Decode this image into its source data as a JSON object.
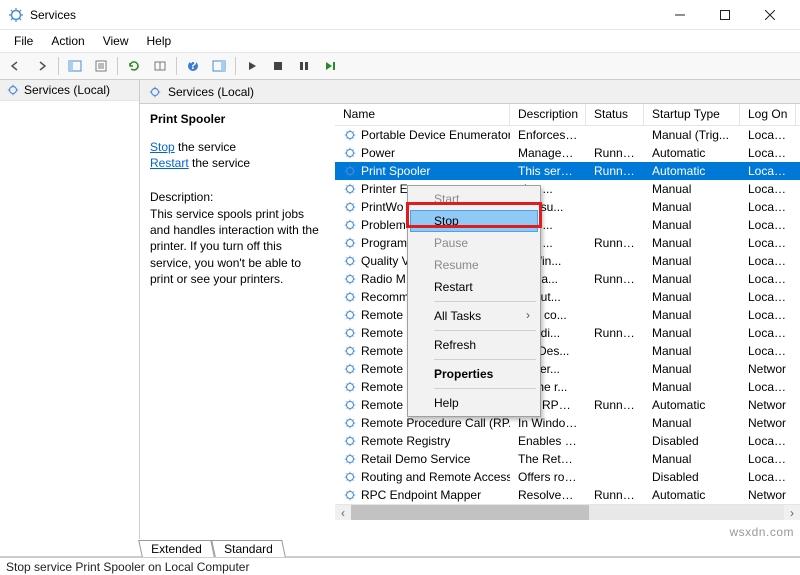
{
  "window": {
    "title": "Services"
  },
  "menus": [
    "File",
    "Action",
    "View",
    "Help"
  ],
  "left": {
    "node": "Services (Local)"
  },
  "header": {
    "title": "Services (Local)"
  },
  "detail": {
    "title": "Print Spooler",
    "action_stop_link": "Stop",
    "action_stop_rest": " the service",
    "action_restart_link": "Restart",
    "action_restart_rest": " the service",
    "desc_heading": "Description:",
    "desc_text": "This service spools print jobs and handles interaction with the printer. If you turn off this service, you won't be able to print or see your printers."
  },
  "columns": [
    "Name",
    "Description",
    "Status",
    "Startup Type",
    "Log On"
  ],
  "rows": [
    {
      "name": "Portable Device Enumerator...",
      "desc": "Enforces gr...",
      "status": "",
      "startup": "Manual (Trig...",
      "logon": "Local Sy"
    },
    {
      "name": "Power",
      "desc": "Manages p...",
      "status": "Running",
      "startup": "Automatic",
      "logon": "Local Sy"
    },
    {
      "name": "Print Spooler",
      "desc": "This service ...",
      "status": "Running",
      "startup": "Automatic",
      "logon": "Local Sy",
      "selected": true
    },
    {
      "name": "Printer E",
      "desc": "vice ...",
      "status": "",
      "startup": "Manual",
      "logon": "Local Sy"
    },
    {
      "name": "PrintWo",
      "desc": "des su...",
      "status": "",
      "startup": "Manual",
      "logon": "Local Sy"
    },
    {
      "name": "Problem",
      "desc": "vice ...",
      "status": "",
      "startup": "Manual",
      "logon": "Local Sy"
    },
    {
      "name": "Program",
      "desc": "vice ...",
      "status": "Running",
      "startup": "Manual",
      "logon": "Local Sy"
    },
    {
      "name": "Quality V",
      "desc": "ty Win...",
      "status": "",
      "startup": "Manual",
      "logon": "Local Sy"
    },
    {
      "name": "Radio M",
      "desc": "Mana...",
      "status": "Running",
      "startup": "Manual",
      "logon": "Local Sy"
    },
    {
      "name": "Recomm",
      "desc": "es aut...",
      "status": "",
      "startup": "Manual",
      "logon": "Local Sy"
    },
    {
      "name": "Remote",
      "desc": "es a co...",
      "status": "",
      "startup": "Manual",
      "logon": "Local Sy"
    },
    {
      "name": "Remote",
      "desc": "ges di...",
      "status": "Running",
      "startup": "Manual",
      "logon": "Local Sy"
    },
    {
      "name": "Remote",
      "desc": "ote Des...",
      "status": "",
      "startup": "Manual",
      "logon": "Local Sy"
    },
    {
      "name": "Remote",
      "desc": "s user...",
      "status": "",
      "startup": "Manual",
      "logon": "Networ"
    },
    {
      "name": "Remote",
      "desc": "es the r...",
      "status": "",
      "startup": "Manual",
      "logon": "Local Sy"
    },
    {
      "name": "Remote Procedure Call (RPC)",
      "desc": "The RPCSS s...",
      "status": "Running",
      "startup": "Automatic",
      "logon": "Networ"
    },
    {
      "name": "Remote Procedure Call (RP...",
      "desc": "In Windows...",
      "status": "",
      "startup": "Manual",
      "logon": "Networ"
    },
    {
      "name": "Remote Registry",
      "desc": "Enables rem...",
      "status": "",
      "startup": "Disabled",
      "logon": "Local Sy"
    },
    {
      "name": "Retail Demo Service",
      "desc": "The Retail D...",
      "status": "",
      "startup": "Manual",
      "logon": "Local Sy"
    },
    {
      "name": "Routing and Remote Access",
      "desc": "Offers routi...",
      "status": "",
      "startup": "Disabled",
      "logon": "Local Sy"
    },
    {
      "name": "RPC Endpoint Mapper",
      "desc": "Resolves RP...",
      "status": "Running",
      "startup": "Automatic",
      "logon": "Networ"
    }
  ],
  "context_menu": {
    "items": [
      {
        "label": "Start",
        "disabled": true
      },
      {
        "label": "Stop",
        "hot": true
      },
      {
        "label": "Pause",
        "disabled": true
      },
      {
        "label": "Resume",
        "disabled": true
      },
      {
        "label": "Restart"
      },
      {
        "sep": true
      },
      {
        "label": "All Tasks",
        "sub": true
      },
      {
        "sep": true
      },
      {
        "label": "Refresh"
      },
      {
        "sep": true
      },
      {
        "label": "Properties",
        "bold": true
      },
      {
        "sep": true
      },
      {
        "label": "Help"
      }
    ]
  },
  "tabs": {
    "extended": "Extended",
    "standard": "Standard"
  },
  "statusbar": "Stop service Print Spooler on Local Computer",
  "watermark": "wsxdn.com"
}
